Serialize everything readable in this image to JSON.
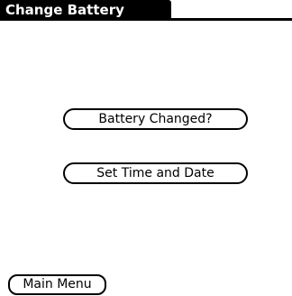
{
  "header": {
    "title": "Change Battery"
  },
  "actions": {
    "battery_changed_label": "Battery Changed?",
    "set_time_date_label": "Set Time and Date"
  },
  "footer": {
    "main_menu_label": "Main Menu"
  },
  "colors": {
    "background": "#ffffff",
    "foreground": "#000000"
  }
}
